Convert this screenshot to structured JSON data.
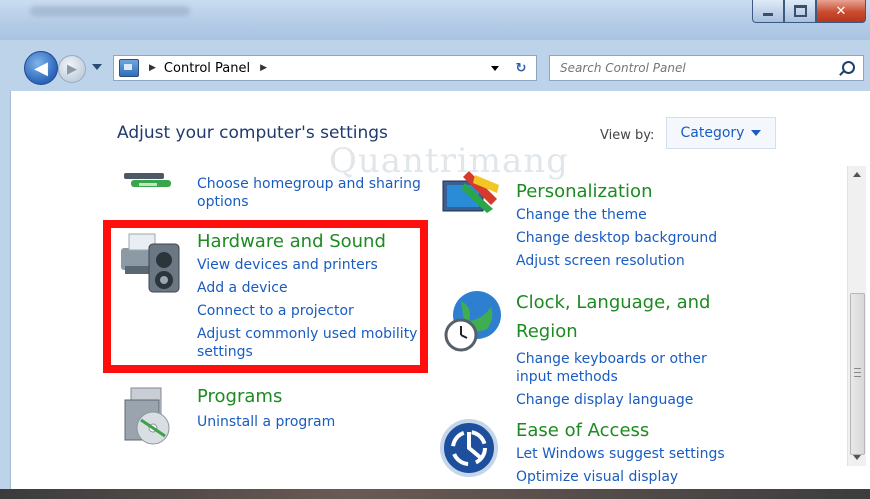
{
  "window": {
    "close_glyph": "✕"
  },
  "nav": {
    "back_glyph": "◀",
    "forward_glyph": "▶",
    "refresh_glyph": "↻",
    "search_placeholder": "Search Control Panel"
  },
  "breadcrumb": {
    "items": [
      "Control Panel"
    ]
  },
  "page": {
    "title": "Adjust your computer's settings",
    "view_by_label": "View by:",
    "view_by_value": "Category"
  },
  "watermark": "Quantrimang",
  "categories": {
    "network": {
      "links": [
        "Choose homegroup and sharing",
        "options"
      ]
    },
    "hardware": {
      "title": "Hardware and Sound",
      "links": [
        "View devices and printers",
        "Add a device",
        "Connect to a projector",
        "Adjust commonly used mobility",
        "settings"
      ]
    },
    "programs": {
      "title": "Programs",
      "links": [
        "Uninstall a program"
      ]
    },
    "personalization": {
      "title": "Personalization",
      "links": [
        "Change the theme",
        "Change desktop background",
        "Adjust screen resolution"
      ]
    },
    "clock": {
      "title_line1": "Clock, Language, and",
      "title_line2": "Region",
      "links": [
        "Change keyboards or other",
        "input methods",
        "Change display language"
      ]
    },
    "ease": {
      "title": "Ease of Access",
      "links": [
        "Let Windows suggest settings",
        "Optimize visual display"
      ]
    }
  },
  "colors": {
    "highlight": "#ff0e0e",
    "link": "#1a5cc1",
    "category_title": "#1d8a22"
  }
}
